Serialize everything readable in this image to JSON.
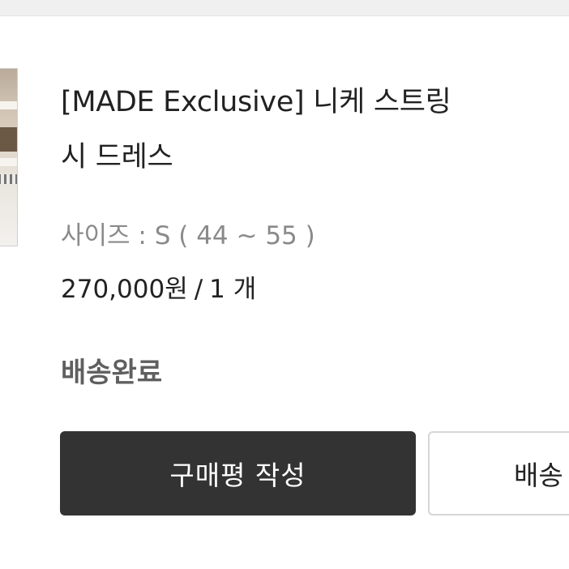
{
  "order_item": {
    "thumbnail_icon": "product-image",
    "title_line1": "[MADE Exclusive] 니케 스트링 ",
    "title_line2": "시 드레스",
    "option": "사이즈 : S ( 44 ~ 55 )",
    "price": "270,000원",
    "price_separator": "/",
    "quantity": "1 개",
    "status": "배송완료",
    "review_button_label": "구매평 작성",
    "second_button_label": "배송"
  },
  "colors": {
    "primary_button_bg": "#333333",
    "status_text": "#5f5f5f",
    "option_text": "#8a8a8a",
    "background": "#f0f0f0"
  }
}
